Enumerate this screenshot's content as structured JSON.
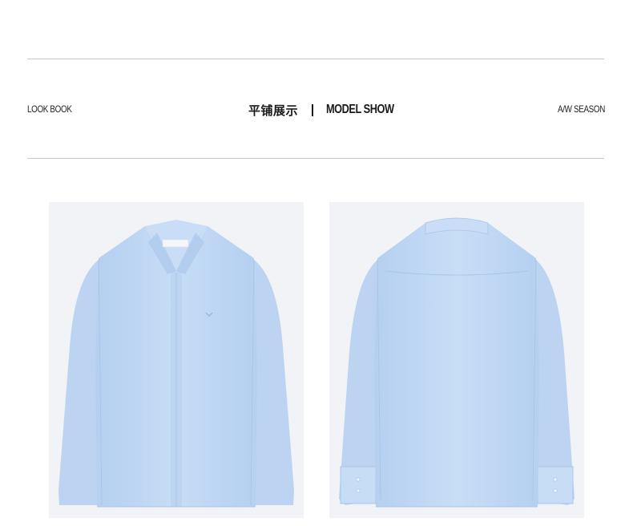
{
  "header": {
    "left_label": "LOOK BOOK",
    "title_cn": "平铺展示",
    "separator": "|",
    "title_en": "MODEL SHOW",
    "right_label": "A/W SEASON"
  },
  "products": [
    {
      "view": "front",
      "image": "shirt-front-icon"
    },
    {
      "view": "back",
      "image": "shirt-back-icon"
    }
  ],
  "colors": {
    "shirt": "#c2d9f3",
    "shirt_shadow": "#a9c5e6",
    "photo_bg": "#f1f3f6",
    "rule": "#c9c9c9"
  }
}
